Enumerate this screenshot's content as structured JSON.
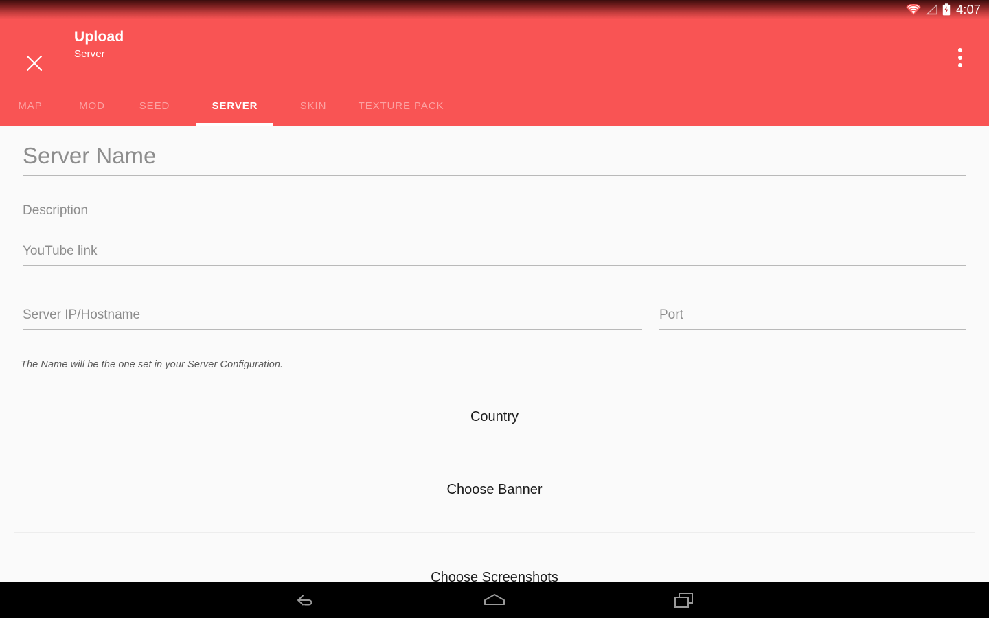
{
  "status_bar": {
    "time": "4:07",
    "icons": [
      "wifi-icon",
      "signal-icon",
      "battery-charging-icon"
    ]
  },
  "app_bar": {
    "close_icon": "close-icon",
    "title": "Upload",
    "subtitle": "Server",
    "overflow_icon": "overflow-menu-icon"
  },
  "tabs": [
    {
      "label": "MAP",
      "active": false
    },
    {
      "label": "MOD",
      "active": false
    },
    {
      "label": "SEED",
      "active": false
    },
    {
      "label": "SERVER",
      "active": true
    },
    {
      "label": "SKIN",
      "active": false
    },
    {
      "label": "TEXTURE PACK",
      "active": false
    }
  ],
  "form": {
    "server_name": {
      "value": "",
      "placeholder": "Server Name"
    },
    "description": {
      "value": "",
      "placeholder": "Description"
    },
    "youtube_link": {
      "value": "",
      "placeholder": "YouTube link"
    },
    "server_ip": {
      "value": "",
      "placeholder": "Server IP/Hostname"
    },
    "port": {
      "value": "",
      "placeholder": "Port"
    },
    "hint": "The Name will be the one set in your Server Configuration."
  },
  "actions": {
    "country": "Country",
    "choose_banner": "Choose Banner",
    "choose_screenshots": "Choose Screenshots"
  },
  "nav_bar": {
    "back": "back-icon",
    "home": "home-icon",
    "recents": "recents-icon"
  },
  "colors": {
    "accent": "#F95454",
    "status_bar_dark": "#3B0D0D",
    "content_background": "#FAFAFA",
    "placeholder_text": "#8D8D8D",
    "underline": "#B9B9B9",
    "divider": "#EDEDED",
    "nav_bar": "#000000"
  }
}
